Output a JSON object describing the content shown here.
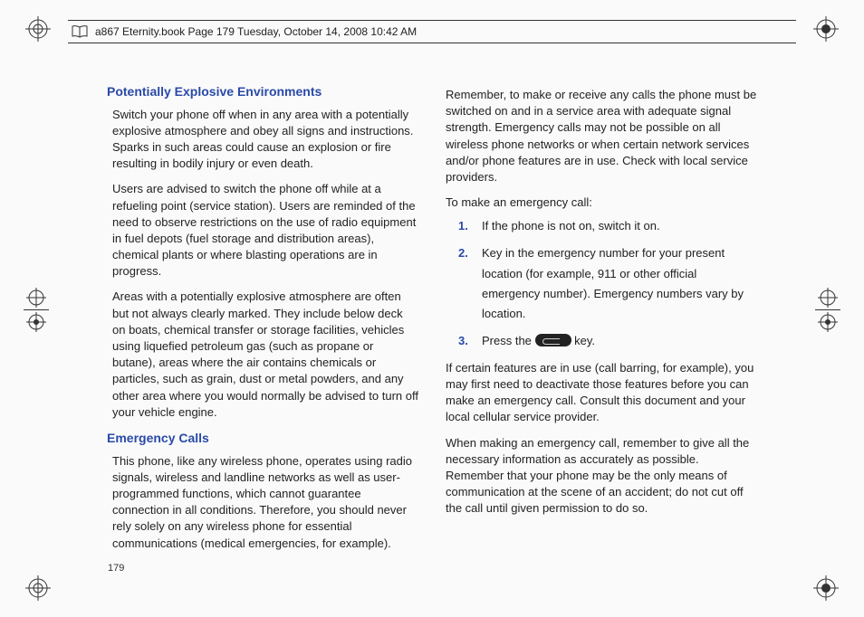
{
  "header": {
    "text": "a867 Eternity.book  Page 179  Tuesday, October 14, 2008  10:42 AM"
  },
  "page_number": "179",
  "left_column": {
    "heading1": "Potentially Explosive Environments",
    "p1": "Switch your phone off when in any area with a potentially explosive atmosphere and obey all signs and instructions. Sparks in such areas could cause an explosion or fire resulting in bodily injury or even death.",
    "p2": "Users are advised to switch the phone off while at a refueling point (service station). Users are reminded of the need to observe restrictions on the use of radio equipment in fuel depots (fuel storage and distribution areas), chemical plants or where blasting operations are in progress.",
    "p3": "Areas with a potentially explosive atmosphere are often but not always clearly marked. They include below deck on boats, chemical transfer or storage facilities, vehicles using liquefied petroleum gas (such as propane or butane), areas where the air contains chemicals or particles, such as grain, dust or metal powders, and any other area where you would normally be advised to turn off your vehicle engine.",
    "heading2": "Emergency Calls",
    "p4": "This phone, like any wireless phone, operates using radio signals, wireless and landline networks as well as user-programmed functions, which cannot guarantee connection in all conditions. Therefore, you should never rely solely on any wireless phone for essential communications (medical emergencies, for example)."
  },
  "right_column": {
    "p1": "Remember, to make or receive any calls the phone must be switched on and in a service area with adequate signal strength. Emergency calls may not be possible on all wireless phone networks or when certain network services and/or phone features are in use. Check with local service providers.",
    "intro": "To make an emergency call:",
    "steps": {
      "n1": "1.",
      "s1": "If the phone is not on, switch it on.",
      "n2": "2.",
      "s2": "Key in the emergency number for your present location (for example, 911 or other official emergency number). Emergency numbers vary by location.",
      "n3": "3.",
      "s3a": "Press the ",
      "s3b": " key."
    },
    "p2": "If certain features are in use (call barring, for example), you may first need to deactivate those features before you can make an emergency call. Consult this document and your local cellular service provider.",
    "p3": "When making an emergency call, remember to give all the necessary information as accurately as possible. Remember that your phone may be the only means of communication at the scene of an accident; do not cut off the call until given permission to do so."
  }
}
